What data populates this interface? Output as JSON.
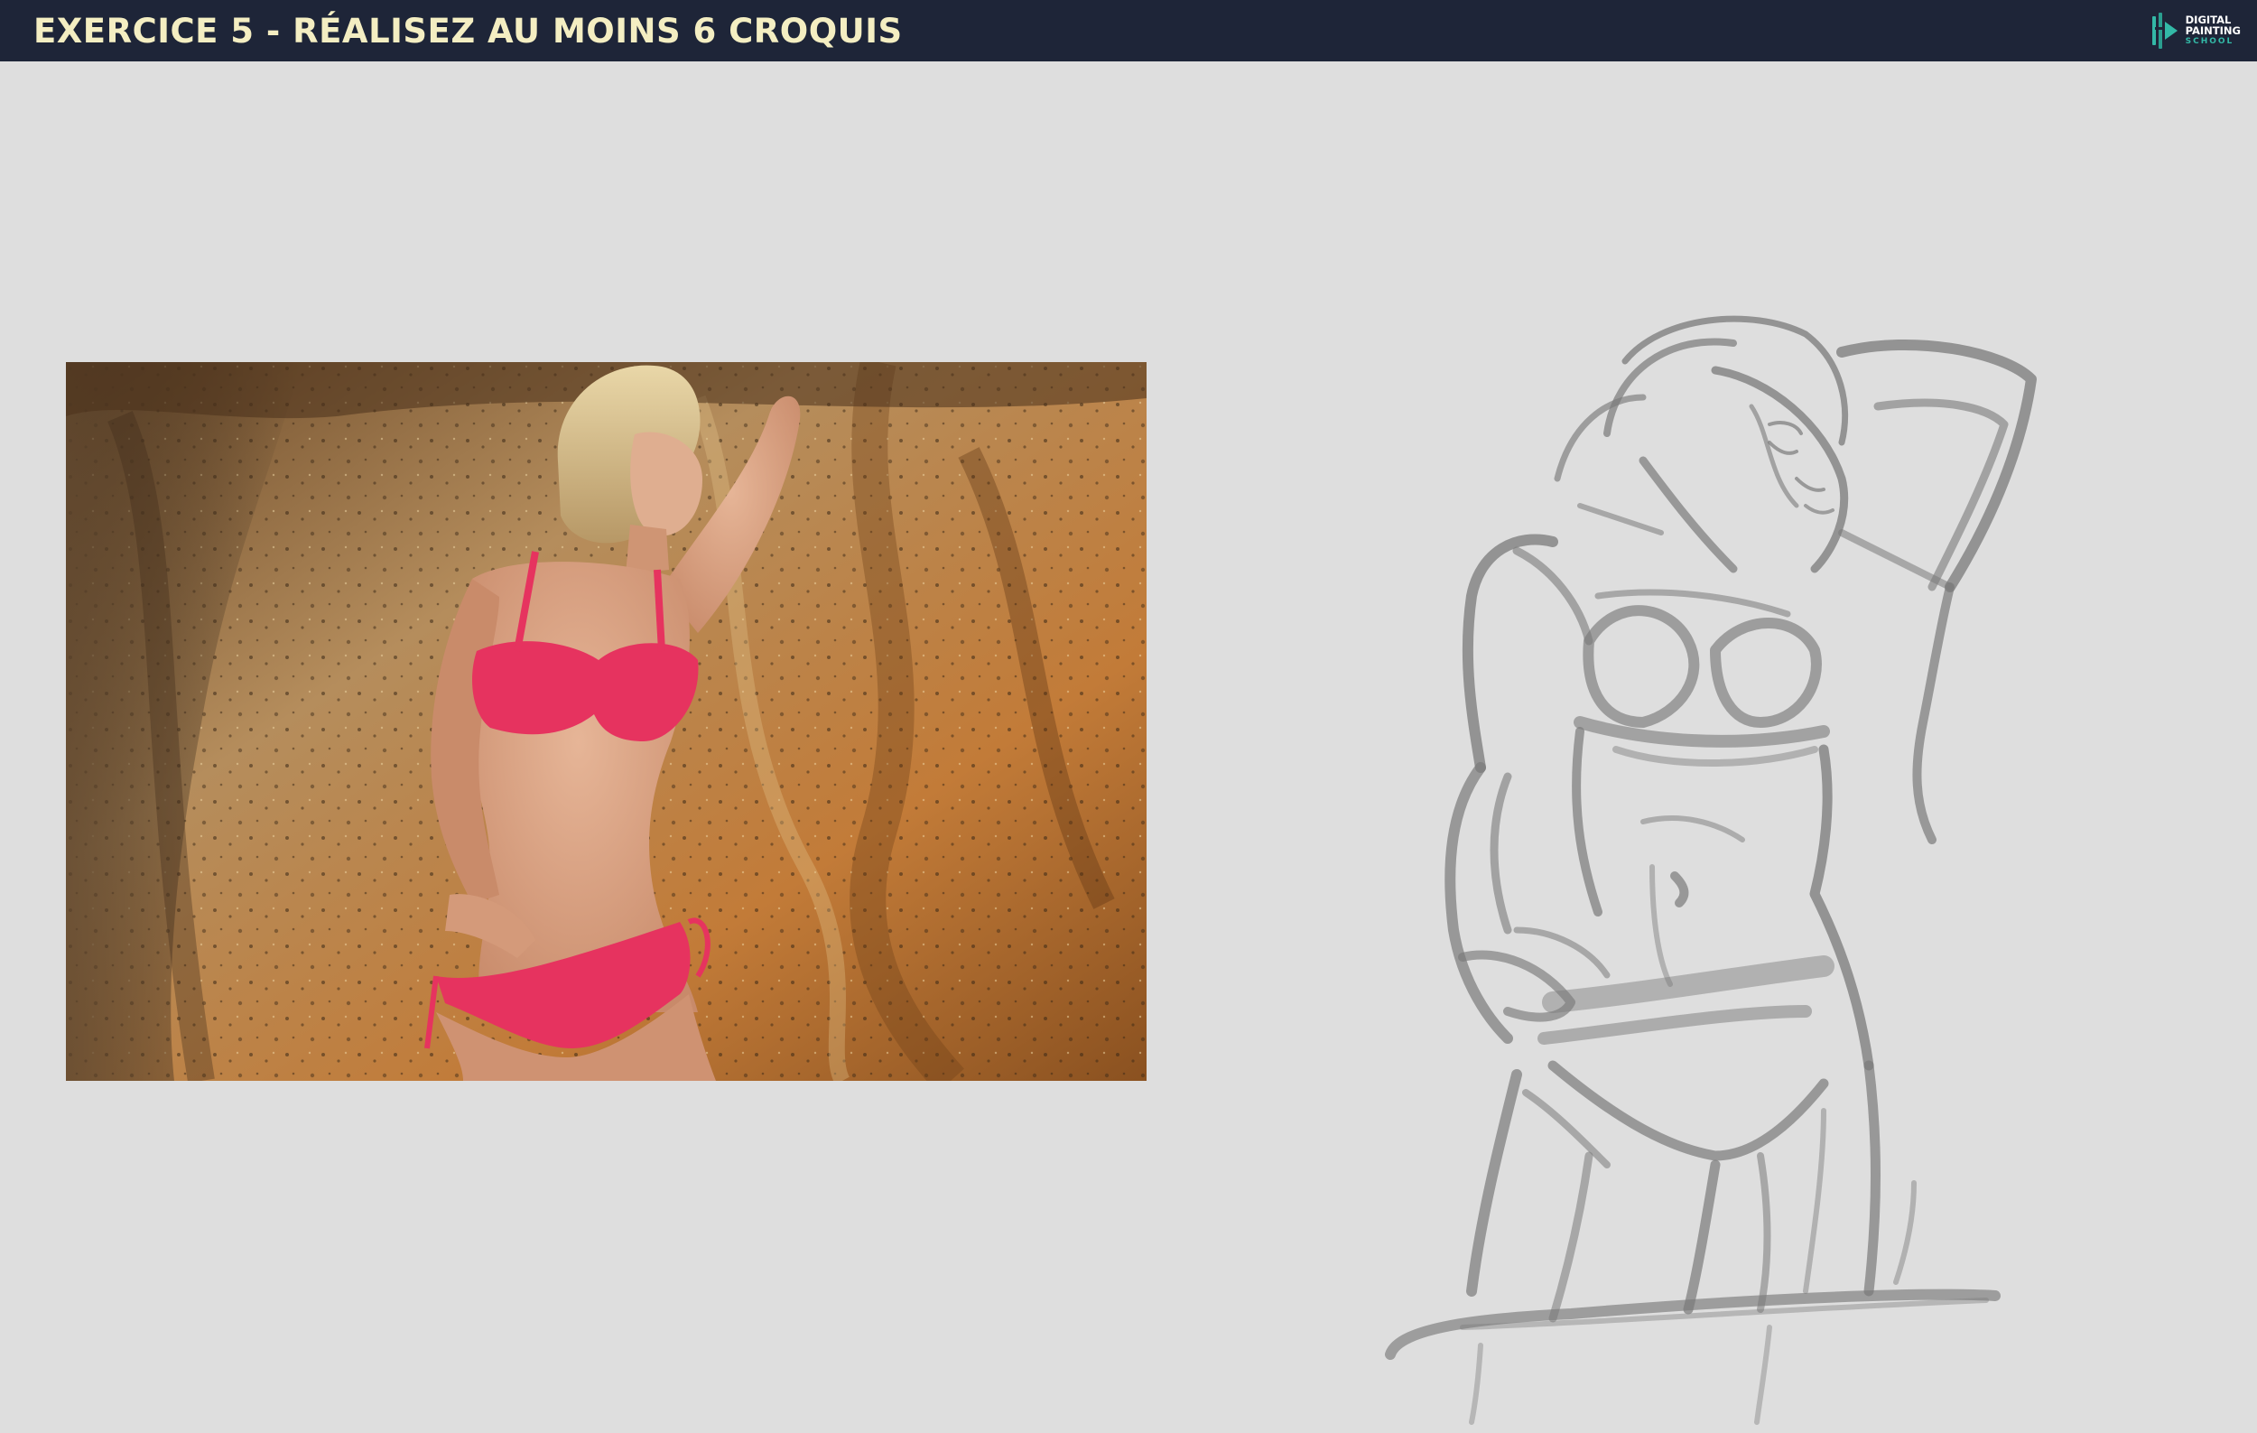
{
  "header": {
    "title": "EXERCICE 5 - RÉALISEZ AU MOINS 6 CROQUIS",
    "background": "#1e2538",
    "title_color": "#f4eec2"
  },
  "logo": {
    "icon": "digital-painting-school-logo-icon",
    "line1": "DIGITAL",
    "line2": "PAINTING",
    "line3": "SCHOOL",
    "accent": "#33b9a7"
  },
  "reference_photo": {
    "icon": "reference-photo-image"
  },
  "sketch": {
    "icon": "gesture-sketch-image",
    "stroke_color": "#7a7a7a"
  },
  "canvas": {
    "background": "#dedede"
  }
}
